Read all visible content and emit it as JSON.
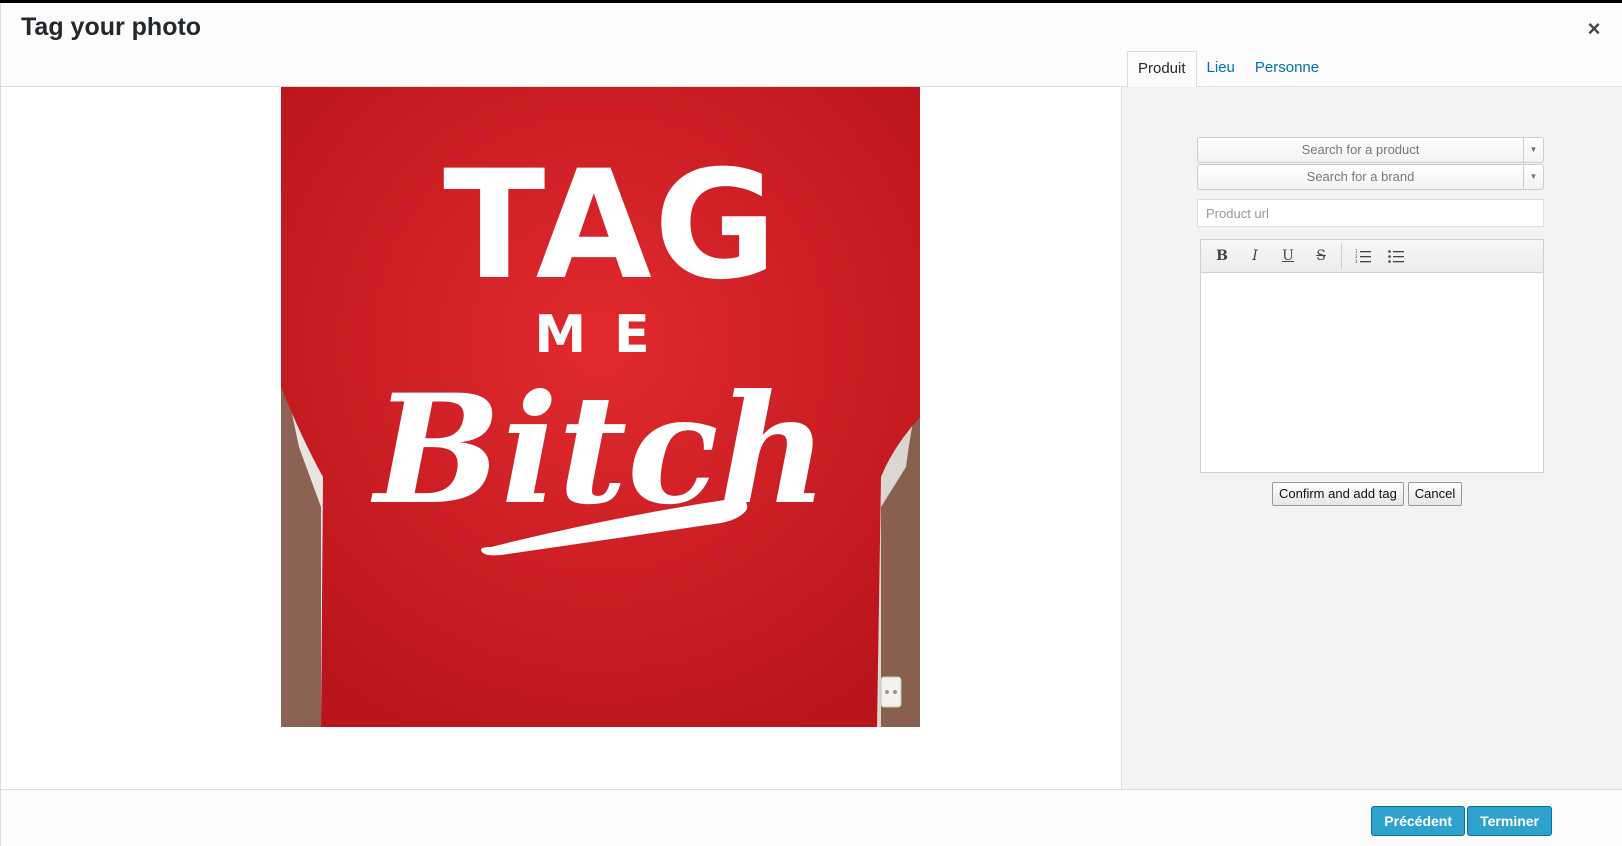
{
  "modal": {
    "title": "Tag your photo",
    "close_glyph": "×"
  },
  "tabs": [
    {
      "label": "Produit",
      "active": true
    },
    {
      "label": "Lieu",
      "active": false
    },
    {
      "label": "Personne",
      "active": false
    }
  ],
  "photo": {
    "shirt_color": "#d21c22",
    "print_lines": [
      "TAG",
      "ME",
      "Bitch"
    ]
  },
  "form": {
    "product_select": {
      "placeholder": "Search for a product",
      "arrow_icon": "triangle-down-icon"
    },
    "brand_select": {
      "placeholder": "Search for a brand",
      "arrow_icon": "triangle-down-icon"
    },
    "url_input": {
      "value": "",
      "placeholder": "Product url"
    },
    "editor": {
      "toolbar": {
        "bold": "B",
        "italic": "I",
        "underline": "U",
        "strike": "S",
        "ordered_list_icon": "ordered-list-icon",
        "bullet_list_icon": "bullet-list-icon"
      },
      "content": ""
    },
    "confirm_label": "Confirm and add tag",
    "cancel_label": "Cancel"
  },
  "footer": {
    "prev_label": "Précédent",
    "finish_label": "Terminer"
  },
  "colors": {
    "primary": "#2ea2cc",
    "link": "#0073aa"
  }
}
